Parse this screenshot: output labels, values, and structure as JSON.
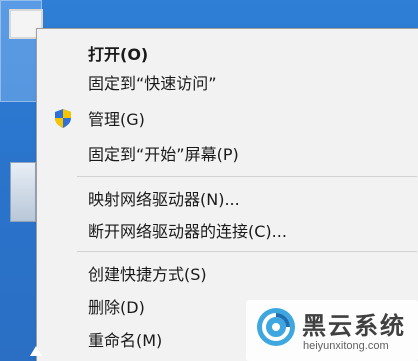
{
  "menu": {
    "items": [
      {
        "label": "打开(O)",
        "bold": true
      },
      {
        "label": "固定到“快速访问”"
      },
      {
        "label": "管理(G)",
        "icon": "uac-shield-icon"
      },
      {
        "label": "固定到“开始”屏幕(P)"
      },
      {
        "label": "映射网络驱动器(N)..."
      },
      {
        "label": "断开网络驱动器的连接(C)..."
      },
      {
        "label": "创建快捷方式(S)"
      },
      {
        "label": "删除(D)"
      },
      {
        "label": "重命名(M)"
      }
    ]
  },
  "watermark": {
    "title": "黑云系统",
    "subtitle": "heiyunxitong.com"
  },
  "colors": {
    "desktop": "#2a74cc",
    "menu_bg": "#f2f2f2",
    "shield_blue": "#2f6fd6",
    "shield_yellow": "#f5c400",
    "watermark_accent": "#3fa7e0"
  }
}
